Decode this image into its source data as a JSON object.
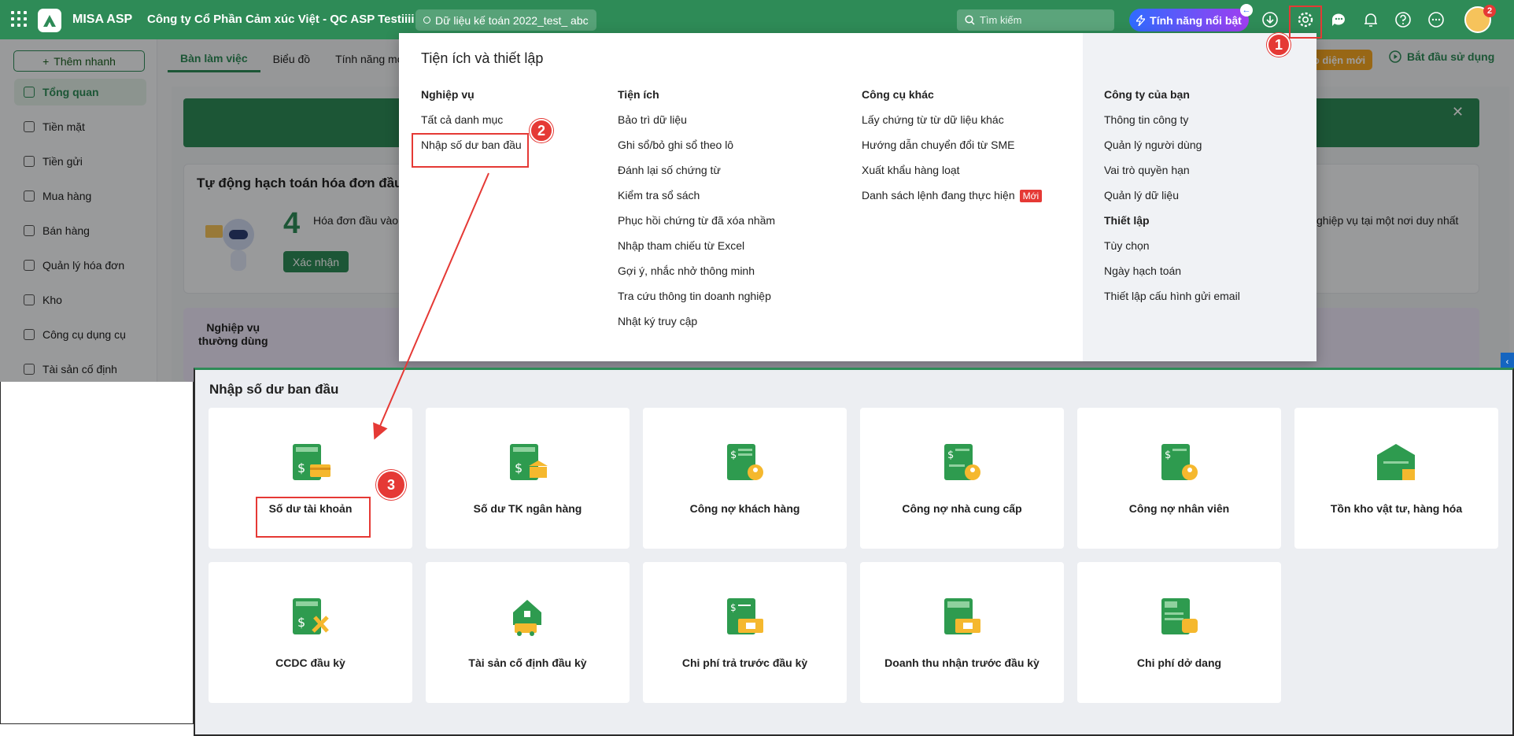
{
  "topbar": {
    "app_name": "MISA ASP",
    "company": "Công ty Cổ Phần Cảm xúc Việt - QC ASP Testiiii",
    "dataset": "Dữ liệu kế toán 2022_test_ abc",
    "search_placeholder": "Tìm kiếm",
    "featured_label": "Tính năng nổi bật",
    "notif_count": "2"
  },
  "sidebar": {
    "quick_add": "Thêm nhanh",
    "items": [
      {
        "label": "Tổng quan",
        "icon": "dashboard-icon"
      },
      {
        "label": "Tiền mặt",
        "icon": "cash-icon"
      },
      {
        "label": "Tiền gửi",
        "icon": "bank-icon"
      },
      {
        "label": "Mua hàng",
        "icon": "purchase-icon"
      },
      {
        "label": "Bán hàng",
        "icon": "cart-icon"
      },
      {
        "label": "Quản lý hóa đơn",
        "icon": "invoice-icon"
      },
      {
        "label": "Kho",
        "icon": "warehouse-icon"
      },
      {
        "label": "Công cụ dụng cụ",
        "icon": "tools-icon"
      },
      {
        "label": "Tài sản cố định",
        "icon": "asset-icon"
      }
    ]
  },
  "tabs": [
    "Bàn làm việc",
    "Biểu đồ",
    "Tính năng mới"
  ],
  "header_right": {
    "new_ui": "o diện mới",
    "start": "Bắt đầu sử dụng"
  },
  "dashboard": {
    "hoadon_title": "Tự động hạch toán hóa đơn đầu v",
    "count": "4",
    "hoadon_text": "Hóa đơn đầu vào c",
    "confirm": "Xác nhận",
    "right_text": "ghiệp vụ tại một nơi duy nhất",
    "nv_label_1": "Nghiệp vụ",
    "nv_label_2": "thường dùng"
  },
  "dropdown": {
    "title": "Tiện ích và thiết lập",
    "col1": {
      "header": "Nghiệp vụ",
      "items": [
        "Tất cả danh mục",
        "Nhập số dư ban đầu"
      ]
    },
    "col2": {
      "header": "Tiện ích",
      "items": [
        "Bảo trì dữ liệu",
        "Ghi sổ/bỏ ghi sổ theo lô",
        "Đánh lại số chứng từ",
        "Kiểm tra sổ sách",
        "Phục hồi chứng từ đã xóa nhầm",
        "Nhập tham chiếu từ Excel",
        "Gợi ý, nhắc nhở thông minh",
        "Tra cứu thông tin doanh nghiệp",
        "Nhật ký truy cập"
      ]
    },
    "col3": {
      "header": "Công cụ khác",
      "items": [
        "Lấy chứng từ từ dữ liệu khác",
        "Hướng dẫn chuyển đổi từ SME",
        "Xuất khẩu hàng loạt",
        "Danh sách lệnh đang thực hiện"
      ],
      "new_badge": "Mới"
    },
    "col4": {
      "header": "Công ty của bạn",
      "items": [
        "Thông tin công ty",
        "Quản lý người dùng",
        "Vai trò quyền hạn",
        "Quản lý dữ liệu"
      ],
      "header2": "Thiết lập",
      "items2": [
        "Tùy chọn",
        "Ngày hạch toán",
        "Thiết lập cấu hình gửi email"
      ]
    }
  },
  "lower": {
    "title": "Nhập số dư ban đầu",
    "tiles": [
      {
        "label": "Số dư tài khoản",
        "icon": "account-balance-icon"
      },
      {
        "label": "Số dư TK ngân hàng",
        "icon": "bank-balance-icon"
      },
      {
        "label": "Công nợ khách hàng",
        "icon": "customer-debt-icon"
      },
      {
        "label": "Công nợ nhà cung cấp",
        "icon": "supplier-debt-icon"
      },
      {
        "label": "Công nợ nhân viên",
        "icon": "employee-debt-icon"
      },
      {
        "label": "Tồn kho vật tư, hàng hóa",
        "icon": "inventory-icon"
      },
      {
        "label": "CCDC đầu kỳ",
        "icon": "tools-opening-icon"
      },
      {
        "label": "Tài sản cố định đầu kỳ",
        "icon": "fixed-asset-opening-icon"
      },
      {
        "label": "Chi phí trả trước đầu kỳ",
        "icon": "prepaid-expense-icon"
      },
      {
        "label": "Doanh thu nhận trước đầu kỳ",
        "icon": "unearned-revenue-icon"
      },
      {
        "label": "Chi phí dở dang",
        "icon": "wip-cost-icon"
      }
    ]
  },
  "steps": [
    "1",
    "2",
    "3"
  ],
  "colors": {
    "brand_green": "#2e8b57",
    "annotation_red": "#e53935"
  }
}
